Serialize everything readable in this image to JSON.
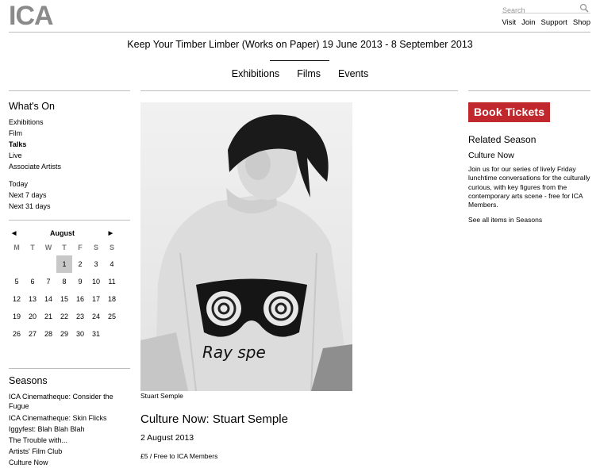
{
  "brand": {
    "logo_text": "ICA"
  },
  "search": {
    "placeholder": "Search"
  },
  "util_nav": [
    {
      "label": "Visit"
    },
    {
      "label": "Join"
    },
    {
      "label": "Support"
    },
    {
      "label": "Shop"
    }
  ],
  "headline": "Keep Your Timber Limber (Works on Paper) 19 June 2013 - 8 September 2013",
  "main_nav": [
    {
      "label": "Exhibitions"
    },
    {
      "label": "Films"
    },
    {
      "label": "Events"
    }
  ],
  "whats_on": {
    "heading": "What's On",
    "categories": [
      {
        "label": "Exhibitions"
      },
      {
        "label": "Film"
      },
      {
        "label": "Talks"
      },
      {
        "label": "Live"
      },
      {
        "label": "Associate Artists"
      }
    ],
    "periods": [
      {
        "label": "Today"
      },
      {
        "label": "Next 7 days"
      },
      {
        "label": "Next 31 days"
      }
    ]
  },
  "calendar": {
    "month": "August",
    "prev_glyph": "◀",
    "next_glyph": "▶",
    "weekdays": [
      "M",
      "T",
      "W",
      "T",
      "F",
      "S",
      "S"
    ],
    "selected_day": "1",
    "weeks": [
      [
        "",
        "",
        "",
        "1",
        "2",
        "3",
        "4"
      ],
      [
        "5",
        "6",
        "7",
        "8",
        "9",
        "10",
        "11"
      ],
      [
        "12",
        "13",
        "14",
        "15",
        "16",
        "17",
        "18"
      ],
      [
        "19",
        "20",
        "21",
        "22",
        "23",
        "24",
        "25"
      ],
      [
        "26",
        "27",
        "28",
        "29",
        "30",
        "31",
        ""
      ]
    ]
  },
  "seasons": {
    "heading": "Seasons",
    "items": [
      {
        "label": "ICA Cinematheque: Consider the Fugue"
      },
      {
        "label": "ICA Cinematheque: Skin Flicks"
      },
      {
        "label": "Iggyfest: Blah Blah Blah"
      },
      {
        "label": "The Trouble with..."
      },
      {
        "label": "Artists' Film Club"
      },
      {
        "label": "Culture Now"
      }
    ]
  },
  "event": {
    "image_caption": "Stuart Semple",
    "sweater_text": "Ray spe",
    "title": "Culture Now: Stuart Semple",
    "date": "2 August 2013",
    "price": "£5 / Free to ICA Members"
  },
  "sidebar_right": {
    "book_label": "Book Tickets",
    "related_heading": "Related Season",
    "related_name": "Culture Now",
    "related_desc": "Join us for our series of lively Friday lunchtime conversations for the culturally curious, with key figures from the contemporary arts scene - free for ICA Members.",
    "related_link": "See all items in Seasons"
  },
  "colors": {
    "book_button": "#c0282d",
    "logo": "#8a8a8a",
    "calendar_selected": "#c8c8c8"
  }
}
